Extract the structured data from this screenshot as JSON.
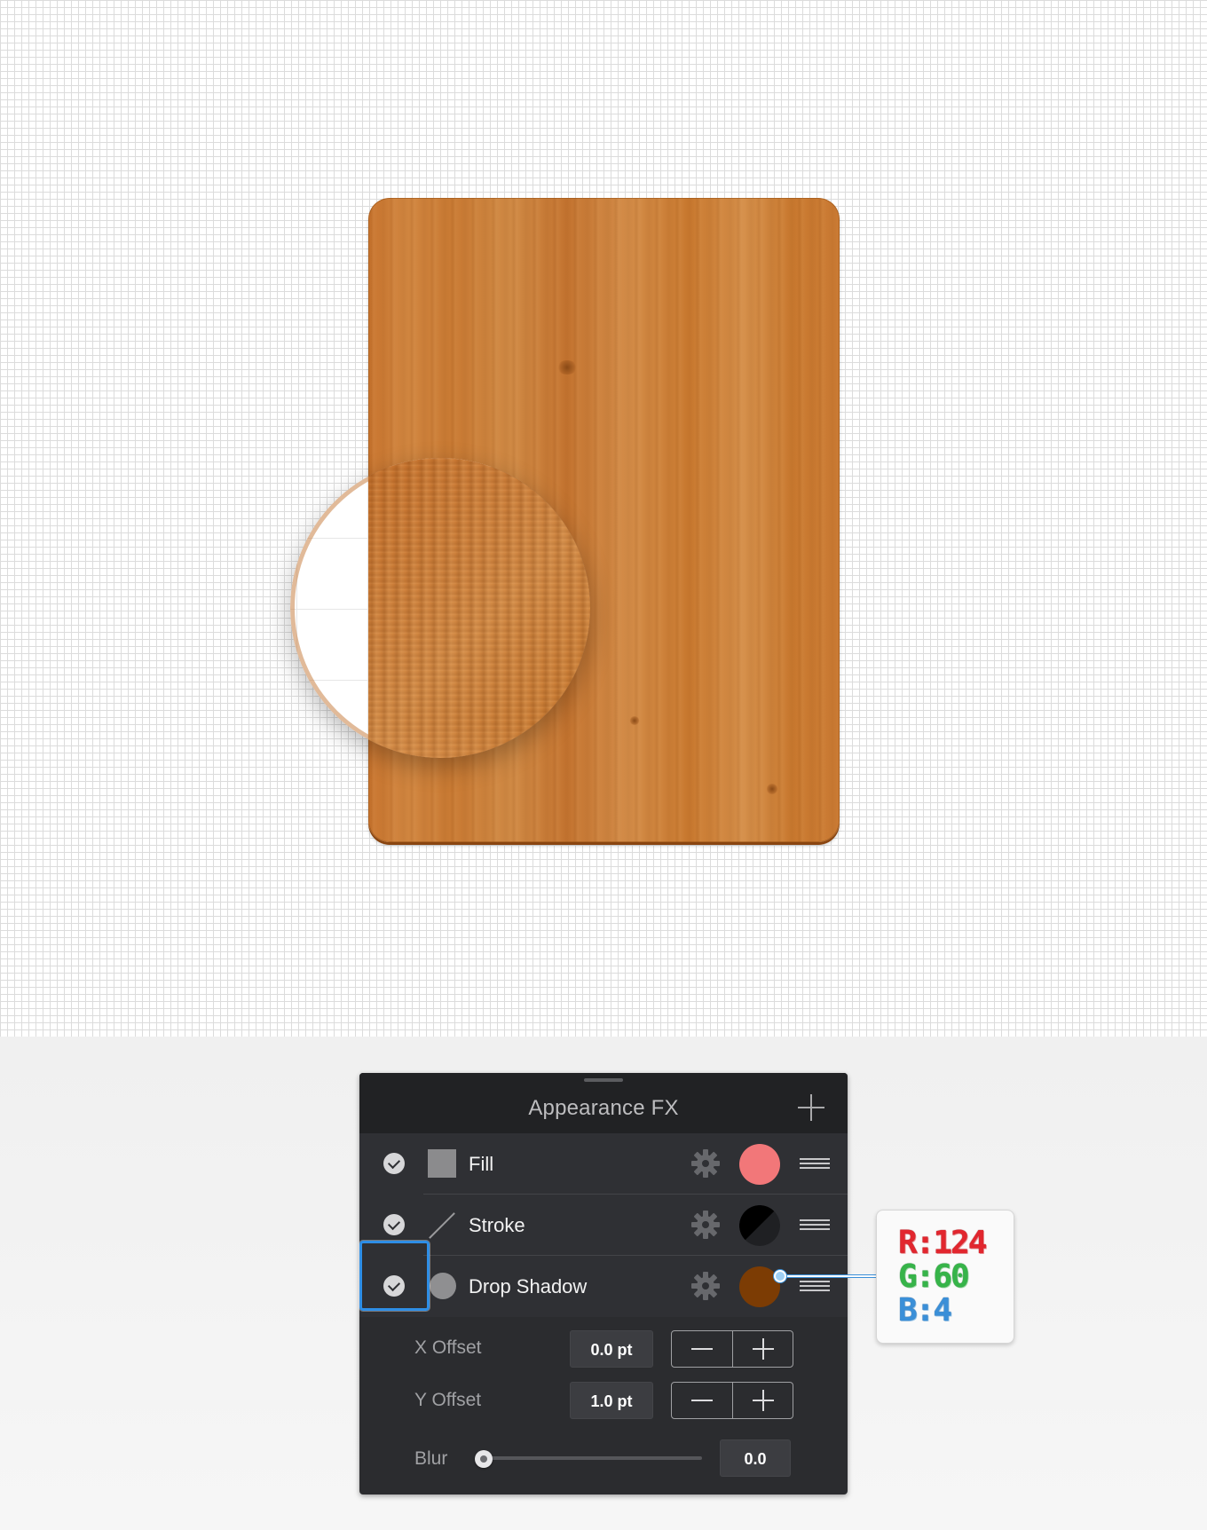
{
  "panel": {
    "title": "Appearance FX",
    "add_icon": "plus-icon",
    "effects": [
      {
        "label": "Fill",
        "enabled": true,
        "icon": "fill-square-icon",
        "color": "#f27779"
      },
      {
        "label": "Stroke",
        "enabled": true,
        "icon": "stroke-line-icon",
        "color": "#000000"
      },
      {
        "label": "Drop Shadow",
        "enabled": true,
        "icon": "shadow-circle-icon",
        "color": "#7c3c04",
        "selected": true
      }
    ],
    "properties": {
      "x_offset": {
        "label": "X Offset",
        "value": "0.0 pt"
      },
      "y_offset": {
        "label": "Y Offset",
        "value": "1.0 pt"
      },
      "blur": {
        "label": "Blur",
        "value": "0.0",
        "slider_fraction": 0
      }
    }
  },
  "callout": {
    "r": "R:124",
    "g": "G:60",
    "b": "B:4"
  },
  "colors": {
    "accent": "#2e8ee6",
    "wood": "#c97a33"
  }
}
